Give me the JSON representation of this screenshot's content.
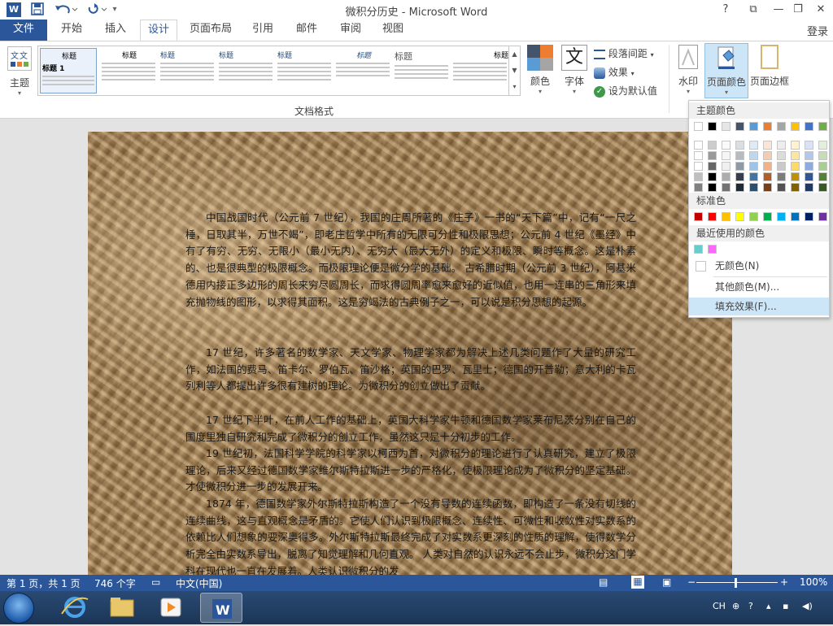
{
  "window": {
    "title": "微积分历史 - Microsoft Word",
    "app_logo": "W",
    "controls": [
      "?",
      "⧉",
      "—",
      "❐",
      "✕"
    ]
  },
  "qat": {
    "save_icon": "save-icon",
    "undo_icon": "undo-icon",
    "redo_icon": "redo-icon"
  },
  "tabs": [
    "文件",
    "开始",
    "插入",
    "设计",
    "页面布局",
    "引用",
    "邮件",
    "审阅",
    "视图"
  ],
  "active_tab": "设计",
  "login_label": "登录",
  "ribbon": {
    "theme_label": "主题",
    "gallery_item_title": "标题",
    "gallery_first_title": "标题 1",
    "group_label": "文档格式",
    "colors_label": "颜色",
    "fonts_label": "字体",
    "fonts_glyph": "文",
    "paragraph_spacing_label": "段落间距",
    "effects_label": "效果",
    "set_default_label": "设为默认值",
    "watermark_label": "水印",
    "page_color_label": "页面颜色",
    "page_border_label": "页面边框"
  },
  "dropdown": {
    "theme_colors_header": "主题颜色",
    "standard_colors_header": "标准色",
    "recent_colors_header": "最近使用的颜色",
    "no_color": "无颜色(N)",
    "more_colors": "其他颜色(M)...",
    "fill_effects": "填充效果(F)...",
    "theme_top_row": [
      "#ffffff",
      "#000000",
      "#e7e6e6",
      "#44546a",
      "#5b9bd5",
      "#ed7d31",
      "#a5a5a5",
      "#ffc000",
      "#4472c4",
      "#70ad47"
    ],
    "standard_colors": [
      "#c00000",
      "#ff0000",
      "#ffc000",
      "#ffff00",
      "#92d050",
      "#00b050",
      "#00b0f0",
      "#0070c0",
      "#002060",
      "#7030a0"
    ],
    "recent_colors": [
      "#66cccc",
      "#ff66ff"
    ]
  },
  "document": {
    "paragraphs": [
      "中国战国时代（公元前 7 世纪），我国的庄周所著的《庄子》一书的“天下篇”中，记有“一尺之棰，日取其半，万世不竭”，即老庄哲学中所有的无限可分性和极限思想；公元前 4 世纪《墨经》中有了有穷、无穷、无限小（最小无内）、无穷大（最大无外）的定义和极限、瞬时等概念。这是朴素的、也是很典型的极限概念。而极限理论便是微分学的基础。    古希腊时期（公元前 3 世纪），阿基米德用内接正多边形的周长来穷尽圆周长，而求得圆周率愈来愈好的近似值，也用一连串的三角形来填充抛物线的图形，以求得其面积。这是穷竭法的古典例子之一，可以说是积分思想的起源。",
      "17 世纪，许多著名的数学家、天文学家、物理学家都为解决上述几类问题作了大量的研究工作，如法国的费马、笛卡尔、罗伯瓦、笛沙格；英国的巴罗、瓦里士；德国的开普勒；意大利的卡瓦列利等人都提出许多很有建树的理论。为微积分的创立做出了贡献。",
      "17 世纪下半叶，在前人工作的基础上，英国大科学家牛顿和德国数学家莱布尼茨分别在自己的国度里独自研究和完成了微积分的创立工作，虽然这只是十分初步的工作。",
      "19 世纪初，法国科学学院的科学家以柯西为首，对微积分的理论进行了认真研究，建立了极限理论，后来又经过德国数学家维尔斯特拉斯进一步的严格化，使极限理论成为了微积分的坚定基础。才使微积分进一步的发展开来。",
      "1874 年，德国数学家外尔斯特拉斯构造了一个没有导数的连续函数，即构造了一条没有切线的连续曲线，这与直观概念是矛盾的。它使人们认识到极限概念、连续性、可微性和收敛性对实数系的依赖比人们想象的要深奥得多。外尔斯特拉斯最终完成了对实数系更深刻的性质的理解，使得数学分析完全由实数系导出，脱离了知觉理解和几何直观。    人类对自然的认识永远不会止步，微积分这门学科在现代也一直在发展着。人类认识微积分的发"
    ]
  },
  "status": {
    "page": "第 1 页，共 1 页",
    "words": "746 个字",
    "language": "中文(中国)",
    "zoom": "100%"
  },
  "tray": {
    "lang": "CH"
  }
}
